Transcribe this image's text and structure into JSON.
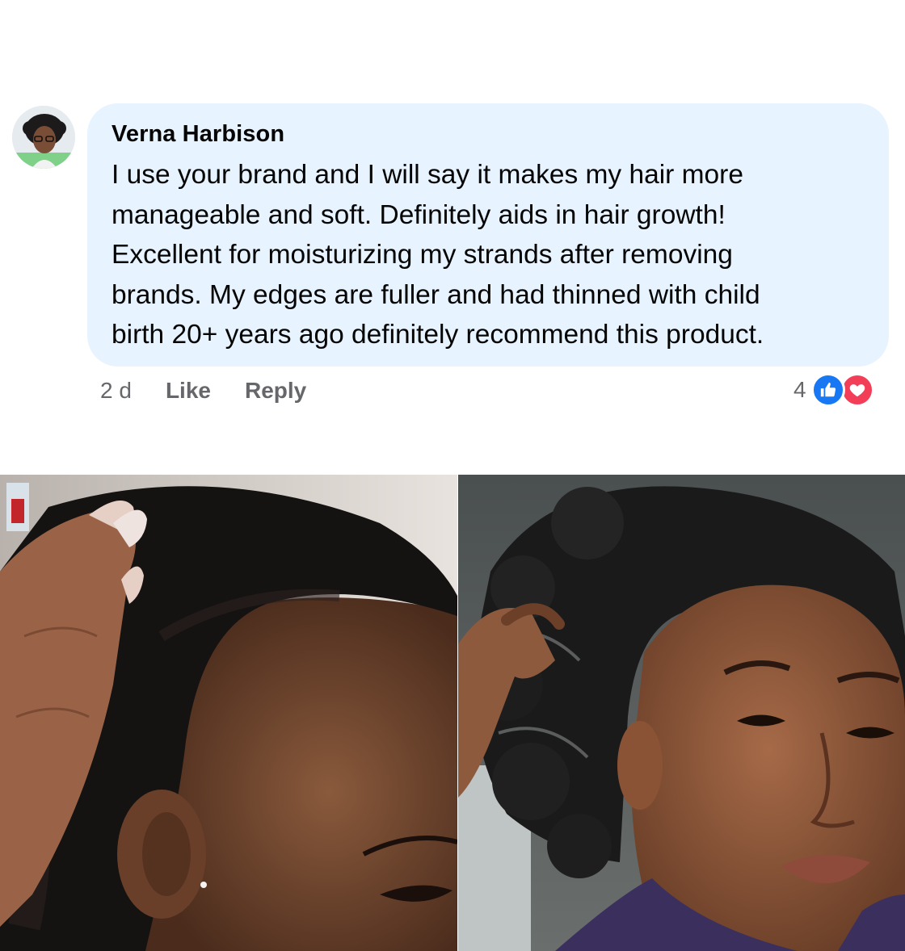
{
  "comment": {
    "author": "Verna Harbison",
    "lines": [
      "I use your brand and I will say it makes my hair more",
      "manageable and soft. Definitely aids in hair growth!",
      "Excellent for moisturizing my strands after removing",
      "brands. My edges are fuller and had thinned with child",
      "birth 20+ years ago definitely recommend this product."
    ],
    "time": "2 d",
    "like_label": "Like",
    "reply_label": "Reply",
    "reaction_count": "4",
    "reaction_icons": [
      "like-icon",
      "love-icon"
    ]
  },
  "colors": {
    "bubble": "#e7f3ff",
    "like": "#1877f2",
    "love": "#f33e58",
    "meta_text": "#65676b"
  },
  "photos": [
    {
      "name": "before-photo"
    },
    {
      "name": "after-photo"
    }
  ]
}
